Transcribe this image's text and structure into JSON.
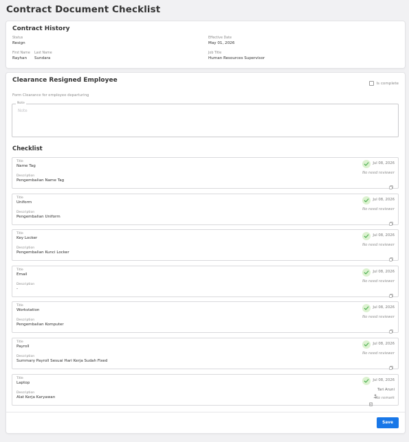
{
  "page": {
    "title": "Contract Document Checklist"
  },
  "contract_history": {
    "title": "Contract History",
    "status_label": "Status",
    "status": "Resign",
    "effective_date_label": "Effective Date",
    "effective_date": "May 01, 2026",
    "first_name_label": "First Name",
    "first_name": "Rayhan",
    "last_name_label": "Last Name",
    "last_name": "Sundara",
    "job_title_label": "Job Title",
    "job_title": "Human Resources Supervisor"
  },
  "clearance": {
    "title": "Clearance Resigned Employee",
    "is_complete_label": "Is complete",
    "is_complete": false,
    "subtitle": "Form Clearance for employee departuring",
    "note_label": "Note",
    "note_placeholder": "Note",
    "note_value": "",
    "checklist_title": "Checklist",
    "items": [
      {
        "title_label": "Title",
        "title": "Name Tag",
        "description_label": "Description",
        "description": "Pengembalian Name Tag",
        "date": "Jul 08, 2026",
        "reviewer": "No need reviewer",
        "status_icon": "check-circle-icon"
      },
      {
        "title_label": "Title",
        "title": "Uniform",
        "description_label": "Description",
        "description": "Pengembalian Uniform",
        "date": "Jul 08, 2026",
        "reviewer": "No need reviewer",
        "status_icon": "check-circle-icon"
      },
      {
        "title_label": "Title",
        "title": "Key Locker",
        "description_label": "Description",
        "description": "Pengembalian Kunci Locker",
        "date": "Jul 08, 2026",
        "reviewer": "No need reviewer",
        "status_icon": "check-circle-icon"
      },
      {
        "title_label": "Title",
        "title": "Email",
        "description_label": "Description",
        "description": "-",
        "date": "Jul 08, 2026",
        "reviewer": "No need reviewer",
        "status_icon": "check-circle-icon"
      },
      {
        "title_label": "Title",
        "title": "Workstation",
        "description_label": "Description",
        "description": "Pengembalian Komputer",
        "date": "Jul 08, 2026",
        "reviewer": "No need reviewer",
        "status_icon": "check-circle-icon"
      },
      {
        "title_label": "Title",
        "title": "Payroll",
        "description_label": "Description",
        "description": "Summary Payroll Sesuai Hari Kerja Sudah Fixed",
        "date": "Jul 08, 2026",
        "reviewer": "No need reviewer",
        "status_icon": "check-circle-icon"
      },
      {
        "title_label": "Title",
        "title": "Laptop",
        "description_label": "Description",
        "description": "Alat Kerja Karyawan",
        "date": "Jul 08, 2026",
        "reviewer_name": "Tari Aruni",
        "remark": "No remark",
        "status_icon": "check-circle-icon"
      }
    ]
  },
  "footer": {
    "save_label": "Save"
  },
  "colors": {
    "accent": "#1877e8",
    "check_bg": "#dcf2d0",
    "check_fg": "#4caf50"
  }
}
